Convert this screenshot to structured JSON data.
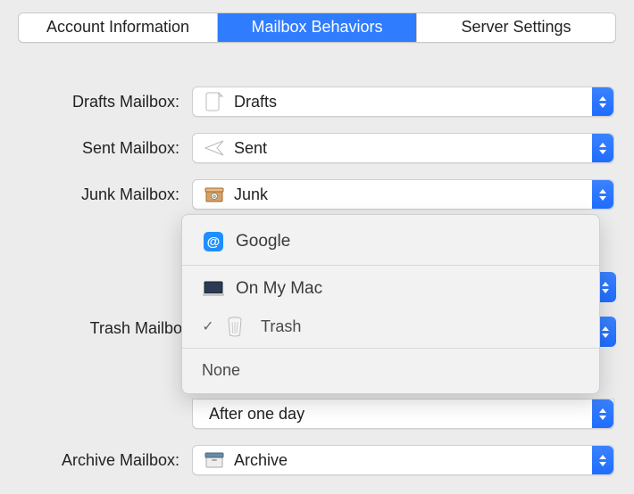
{
  "tabs": {
    "account": "Account Information",
    "behaviors": "Mailbox Behaviors",
    "server": "Server Settings"
  },
  "labels": {
    "drafts": "Drafts Mailbox:",
    "sent": "Sent Mailbox:",
    "junk": "Junk Mailbox:",
    "trash": "Trash Mailbox",
    "archive": "Archive Mailbox:"
  },
  "values": {
    "drafts": "Drafts",
    "sent": "Sent",
    "junk": "Junk",
    "afterOneDay": "After one day",
    "archive": "Archive"
  },
  "menu": {
    "google": "Google",
    "onmymac": "On My Mac",
    "trash": "Trash",
    "none": "None"
  }
}
